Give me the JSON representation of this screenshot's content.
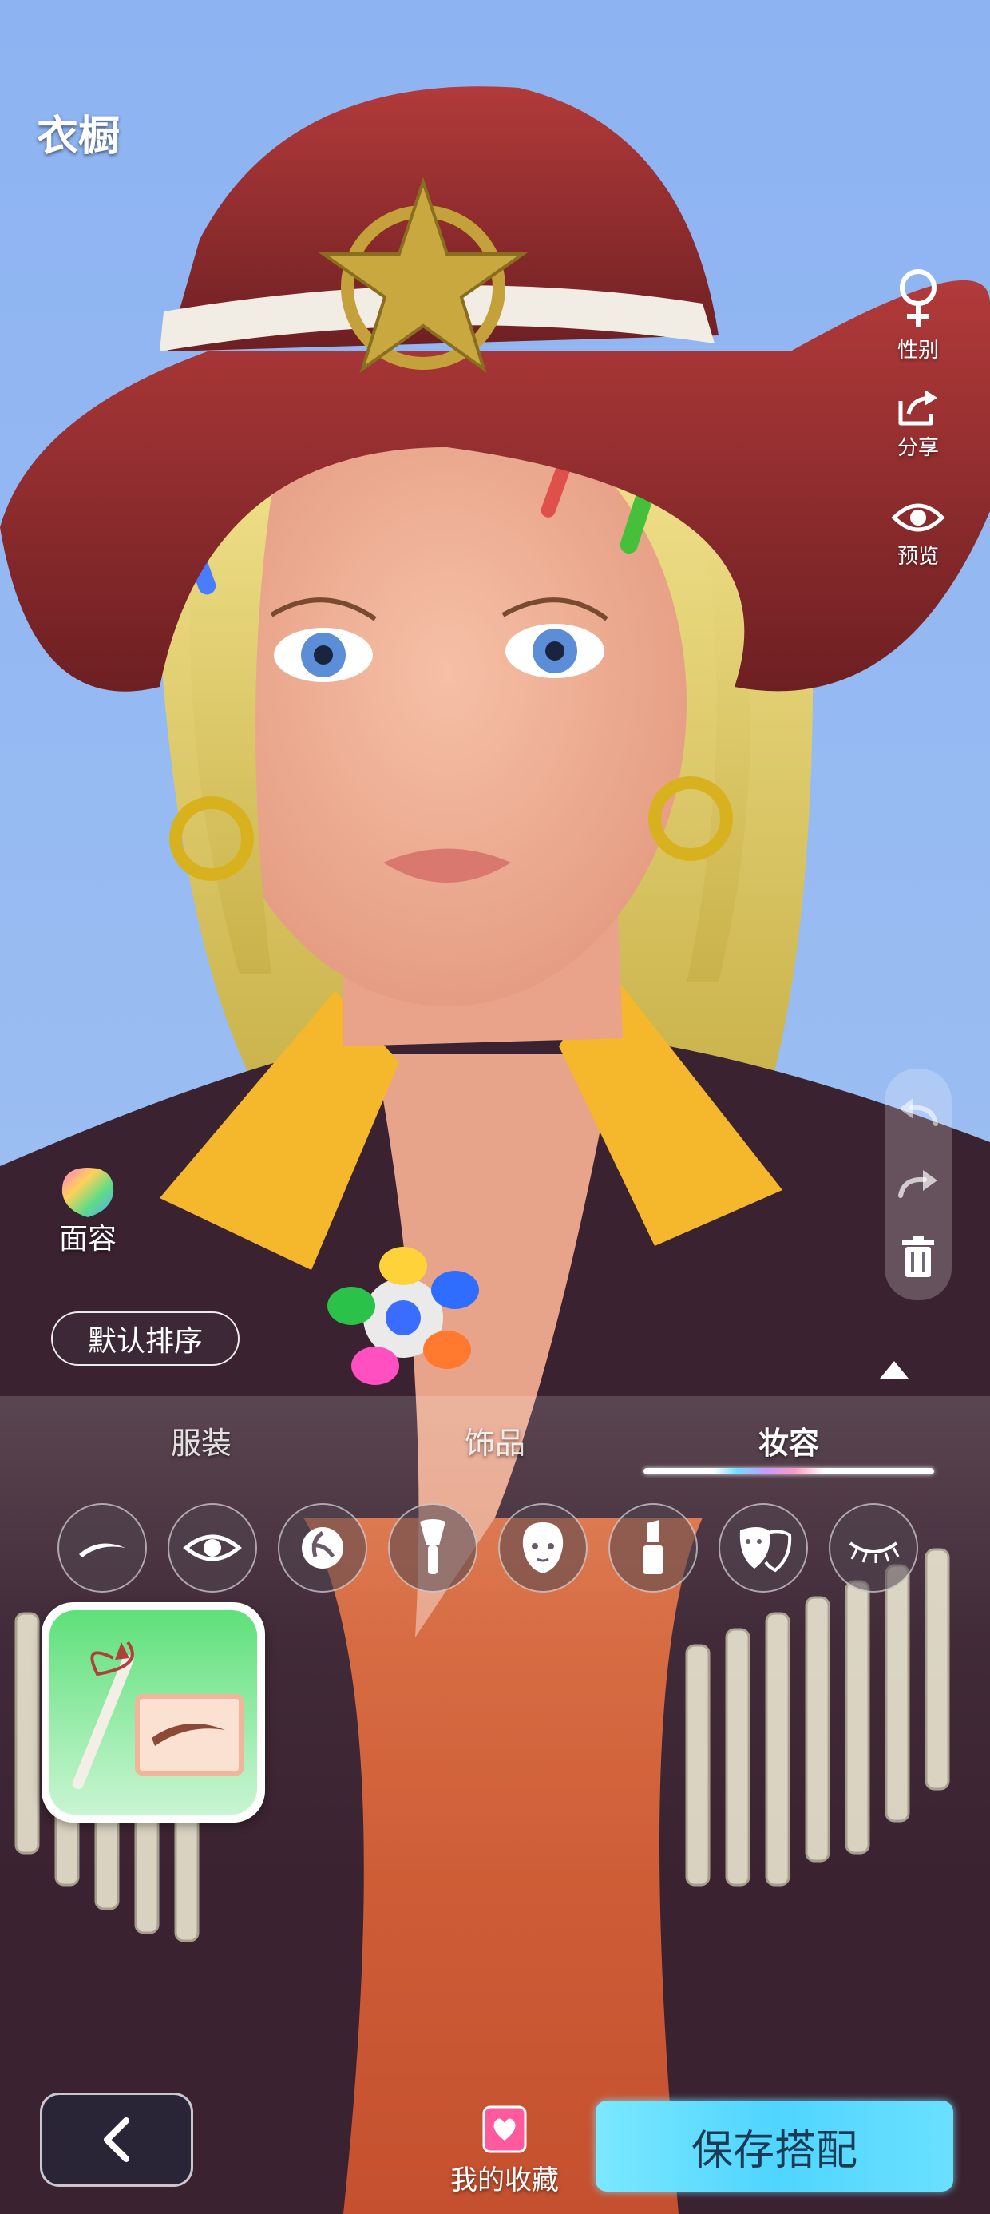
{
  "header": {
    "title": "衣橱"
  },
  "right_rail": {
    "gender_label": "性别",
    "share_label": "分享",
    "preview_label": "预览"
  },
  "face": {
    "label": "面容"
  },
  "sort": {
    "label": "默认排序"
  },
  "tabs": [
    {
      "label": "服装",
      "active": false
    },
    {
      "label": "饰品",
      "active": false
    },
    {
      "label": "妆容",
      "active": true
    }
  ],
  "makeup_categories": [
    {
      "icon": "eyebrow-icon"
    },
    {
      "icon": "eye-icon"
    },
    {
      "icon": "pupil-icon"
    },
    {
      "icon": "makeup-brush-icon"
    },
    {
      "icon": "face-icon"
    },
    {
      "icon": "lipstick-icon"
    },
    {
      "icon": "mask-icon"
    },
    {
      "icon": "eyelash-icon"
    }
  ],
  "bottom": {
    "favorites_label": "我的收藏",
    "save_label": "保存搭配"
  },
  "colors": {
    "accent_save": "#4fd5ff",
    "sky": "#8fb4f0",
    "favorites_pink": "#ff5a9e"
  }
}
